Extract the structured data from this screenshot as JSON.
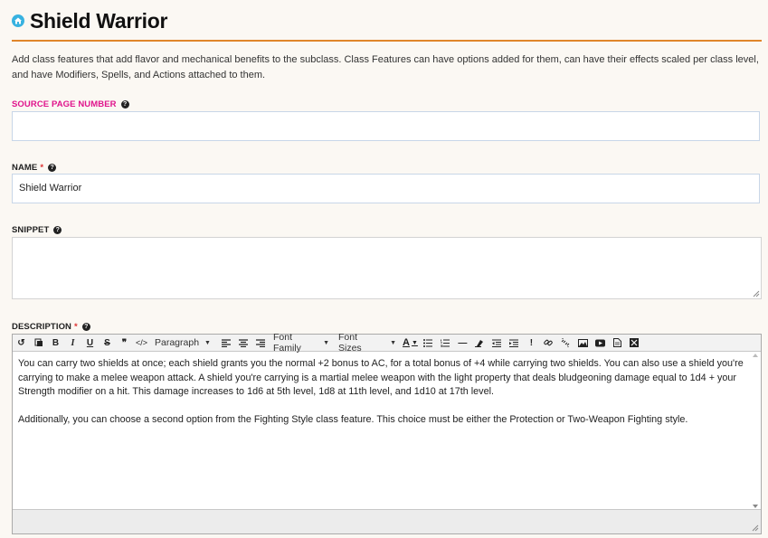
{
  "header": {
    "title": "Shield Warrior"
  },
  "intro": "Add class features that add flavor and mechanical benefits to the subclass. Class Features can have options added for them, can have their effects scaled per class level, and have Modifiers, Spells, and Actions attached to them.",
  "fields": {
    "source_page": {
      "label": "SOURCE PAGE NUMBER",
      "value": ""
    },
    "name": {
      "label": "NAME",
      "required": "*",
      "value": "Shield Warrior"
    },
    "snippet": {
      "label": "SNIPPET",
      "value": ""
    },
    "description": {
      "label": "DESCRIPTION",
      "required": "*"
    }
  },
  "toolbar": {
    "paragraph": "Paragraph",
    "font_family": "Font Family",
    "font_sizes": "Font Sizes",
    "bold": "B",
    "italic": "I",
    "underline": "U",
    "strike": "S",
    "quote": "❞",
    "code": "</>",
    "text_color": "A",
    "hr": "—",
    "important": "!"
  },
  "description": {
    "p1": "You can carry two shields at once; each shield grants you the normal +2 bonus to AC, for a total bonus of +4 while carrying two shields. You can also use a shield you're carrying to make a melee weapon attack. A shield you're carrying is a martial melee weapon with the light property that deals bludgeoning damage equal to 1d4 + your Strength modifier on a hit. This damage increases to 1d6 at 5th level, 1d8 at 11th level, and 1d10 at 17th level.",
    "p2": "Additionally, you can choose a second option from the Fighting Style class feature. This choice must be either the Protection or Two-Weapon Fighting style."
  },
  "colors": {
    "accent_rule": "#e0862b",
    "source_label": "#e0148c",
    "required": "#dd3333",
    "home_icon": "#38b2e0"
  }
}
